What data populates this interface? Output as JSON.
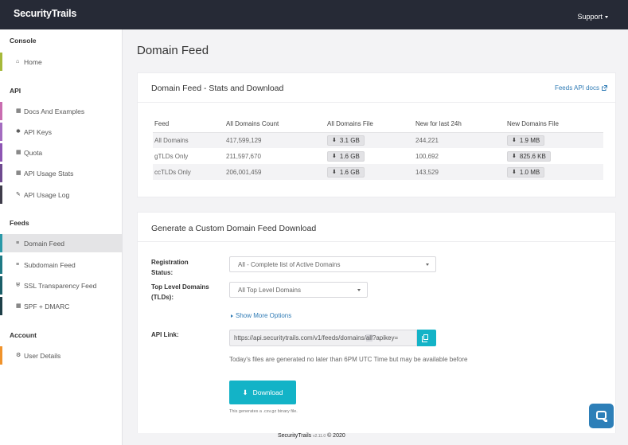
{
  "header": {
    "logo": "SecurityTrails",
    "support_label": "Support"
  },
  "sidebar": {
    "sections": [
      {
        "title": "Console"
      },
      {
        "title": "API"
      },
      {
        "title": "Feeds"
      },
      {
        "title": "Account"
      }
    ],
    "items": [
      {
        "label": "Home",
        "icon": "home-icon",
        "color": "#a6b93a"
      },
      {
        "label": "Docs And Examples",
        "icon": "book-icon",
        "color": "#c96db0"
      },
      {
        "label": "API Keys",
        "icon": "puzzle-icon",
        "color": "#a46cc0"
      },
      {
        "label": "Quota",
        "icon": "grid-icon",
        "color": "#8d55b3"
      },
      {
        "label": "API Usage Stats",
        "icon": "chart-icon",
        "color": "#6e4a8f"
      },
      {
        "label": "API Usage Log",
        "icon": "pencil-icon",
        "color": "#3e3c4a"
      },
      {
        "label": "Domain Feed",
        "icon": "list-icon",
        "color": "#2a99a8",
        "active": true
      },
      {
        "label": "Subdomain Feed",
        "icon": "list-icon",
        "color": "#1f7a85"
      },
      {
        "label": "SSL Transparency Feed",
        "icon": "shield-icon",
        "color": "#1a5e68"
      },
      {
        "label": "SPF + DMARC",
        "icon": "grid-icon",
        "color": "#1d3f48"
      },
      {
        "label": "User Details",
        "icon": "gear-icon",
        "color": "#f0932b"
      }
    ]
  },
  "main": {
    "page_title": "Domain Feed",
    "stats_card": {
      "title": "Domain Feed - Stats and Download",
      "docs_link": "Feeds API docs",
      "columns": [
        "Feed",
        "All Domains Count",
        "All Domains File",
        "New for last 24h",
        "New Domains File"
      ],
      "rows": [
        {
          "feed": "All Domains",
          "count": "417,599,129",
          "file": "3.1 GB",
          "new24h": "244,221",
          "new_file": "1.9 MB"
        },
        {
          "feed": "gTLDs Only",
          "count": "211,597,670",
          "file": "1.6 GB",
          "new24h": "100,692",
          "new_file": "825.6 KB"
        },
        {
          "feed": "ccTLDs Only",
          "count": "206,001,459",
          "file": "1.6 GB",
          "new24h": "143,529",
          "new_file": "1.0 MB"
        }
      ]
    },
    "custom_card": {
      "title": "Generate a Custom Domain Feed Download",
      "registration_label_1": "Registration",
      "registration_label_2": "Status:",
      "registration_value": "All - Complete list of Active Domains",
      "tld_label_1": "Top Level Domains",
      "tld_label_2": "(TLDs):",
      "tld_value": "All Top Level Domains",
      "more_options": "Show More Options",
      "api_link_label": "API Link:",
      "api_link_prefix": "https://api.securitytrails.com/v1/feeds/domains/",
      "api_link_highlight": "all",
      "api_link_suffix": "?apikey=",
      "note": "Today's files are generated no later than 6PM UTC Time but may be available before",
      "download_label": "Download",
      "download_note": "This generates a .csv.gz binary file."
    }
  },
  "footer": {
    "brand": "SecurityTrails",
    "version": "v2.11.0",
    "copyright": "© 2020"
  },
  "colors": {
    "accent": "#13b3c7",
    "topbar": "#262a36",
    "link": "#2f7bb5",
    "chat": "#2d7fb8"
  }
}
